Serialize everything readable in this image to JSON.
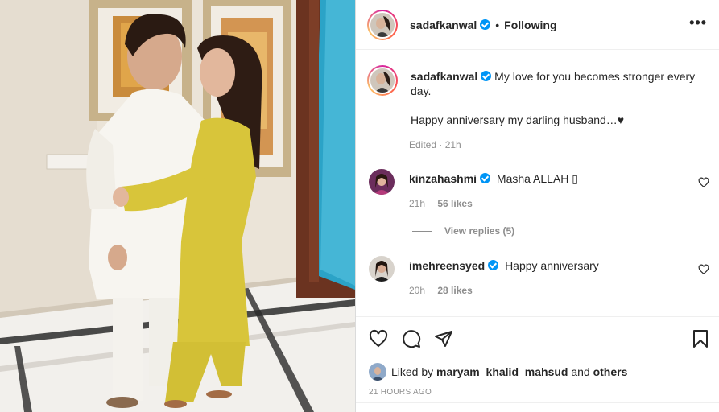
{
  "post": {
    "author": "sadafkanwal",
    "dot": "•",
    "follow_state": "Following",
    "more_icon": "more-horizontal-icon",
    "caption_line1": "My love for you becomes stronger every",
    "caption_line2": "day.",
    "caption_line3": "Happy anniversary my darling husband…♥",
    "caption_meta": "Edited · 21h"
  },
  "comments": [
    {
      "username": "kinzahashmi",
      "text": "Masha ALLAH ▯",
      "age": "21h",
      "likes": "56 likes",
      "replies": "View replies (5)"
    },
    {
      "username": "imehreensyed",
      "text": "Happy anniversary",
      "age": "20h",
      "likes": "28 likes"
    }
  ],
  "actions": {
    "liked_by_prefix": "Liked by",
    "liked_by_user": "maryam_khalid_mahsud",
    "liked_by_and": "and",
    "liked_by_others": "others",
    "timestamp": "21 HOURS AGO"
  },
  "colors": {
    "verified": "#0095f6",
    "muted": "#8e8e8e",
    "text": "#262626",
    "dress_yellow": "#d8c53a"
  }
}
